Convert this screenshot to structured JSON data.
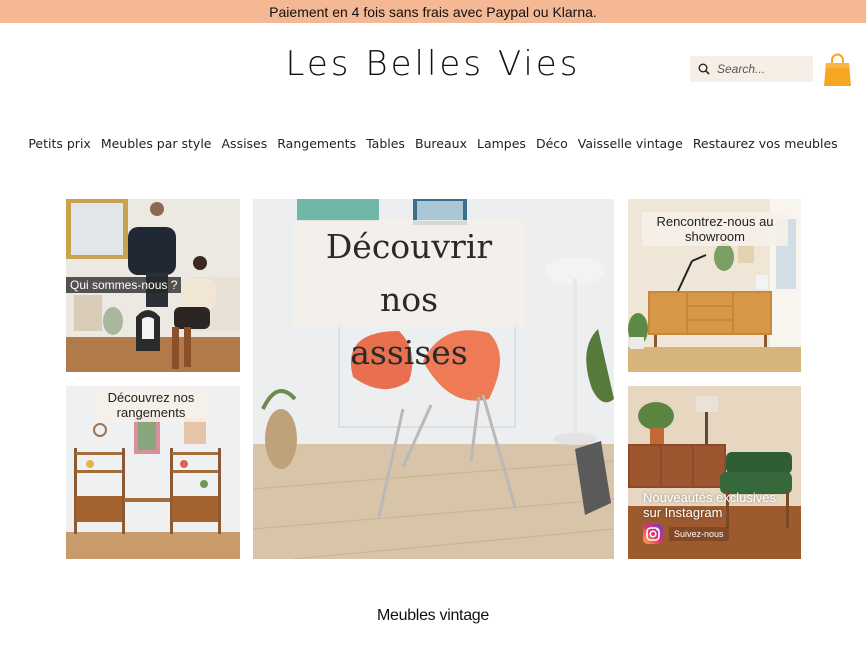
{
  "promo": {
    "text": "Paiement en 4 fois sans frais avec Paypal ou Klarna."
  },
  "header": {
    "logo": "Les Belles Vies",
    "search_placeholder": "Search..."
  },
  "nav": {
    "items": [
      {
        "label": "Petits prix"
      },
      {
        "label": "Meubles par style"
      },
      {
        "label": "Assises"
      },
      {
        "label": "Rangements"
      },
      {
        "label": "Tables"
      },
      {
        "label": "Bureaux"
      },
      {
        "label": "Lampes"
      },
      {
        "label": "Déco"
      },
      {
        "label": "Vaisselle vintage"
      },
      {
        "label": "Restaurez vos meubles"
      }
    ]
  },
  "tiles": {
    "about": {
      "label": "Qui sommes-nous ?"
    },
    "storage": {
      "line1": "Découvrez nos",
      "line2": "rangements"
    },
    "seating": {
      "line1": "Découvrir nos",
      "line2": "assises"
    },
    "showroom": {
      "line1": "Rencontrez-nous au",
      "line2": "showroom"
    },
    "instagram": {
      "line1": "Nouveautés exclusives",
      "line2": "sur Instagram",
      "button": "Suivez-nous"
    }
  },
  "section": {
    "title": "Meubles vintage"
  },
  "colors": {
    "promo_bg": "#f5b895",
    "bag": "#f5a623",
    "search_bg": "#f6efe6",
    "chair": "#e8704f"
  },
  "icons": {
    "search": "search-icon",
    "bag": "shopping-bag-icon",
    "instagram": "instagram-icon"
  }
}
